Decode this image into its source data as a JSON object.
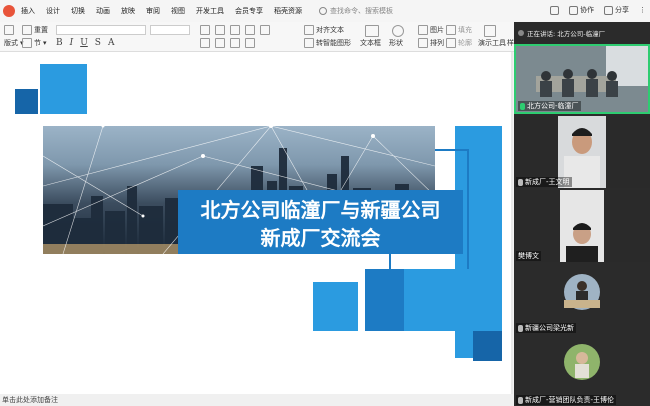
{
  "menubar": {
    "items": [
      "插入",
      "设计",
      "切换",
      "动画",
      "放映",
      "审阅",
      "视图",
      "开发工具",
      "会员专享",
      "稻壳资源"
    ],
    "search_placeholder": "查找命令、搜索模板",
    "right": [
      "协作",
      "分享"
    ]
  },
  "toolbar": {
    "reset": "重置",
    "layout": "版式",
    "section": "节",
    "align_text": "对齐文本",
    "convert_smartart": "转智能图形",
    "textbox": "文本框",
    "shape": "形状",
    "arrange": "排列",
    "picture": "图片",
    "fill": "填充",
    "outline": "轮廓",
    "demo_tools": "演示工具",
    "style": "样式"
  },
  "slide": {
    "title_line1": "北方公司临潼厂与新疆公司",
    "title_line2": "新成厂交流会",
    "colors": {
      "blue": "#1d7bc4",
      "light_blue": "#2b9be0",
      "title_bg": "#1d7bc4"
    }
  },
  "statusbar": {
    "notes_hint": "单击此处添加备注"
  },
  "video_panel": {
    "header": "正在讲话: 北方公司-临潼厂",
    "tiles": [
      {
        "label": "北方公司-临潼厂",
        "mic": "on"
      },
      {
        "label": "新成厂-王文明",
        "mic": "off"
      },
      {
        "label": "樊博文",
        "mic": "none"
      },
      {
        "label": "新疆公司梁光新",
        "mic": "off"
      },
      {
        "label": "新成厂-营销团队负责-王博伦",
        "mic": "off"
      }
    ]
  }
}
